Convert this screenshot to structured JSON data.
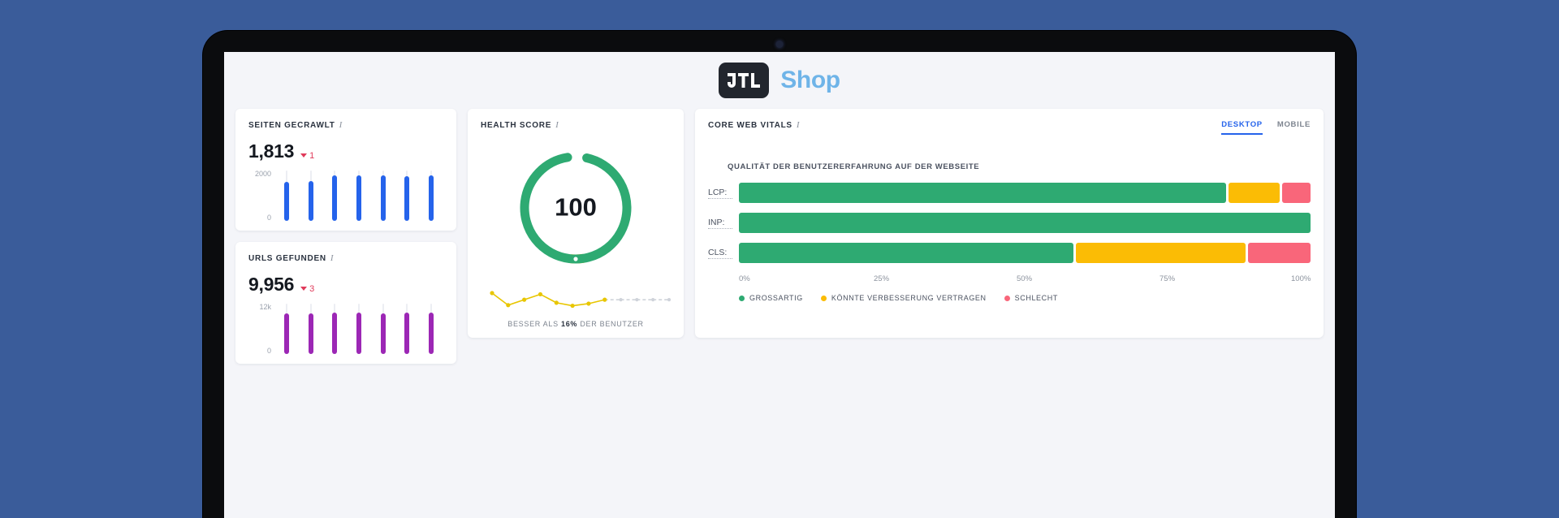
{
  "brand": {
    "mark_text": "JTL",
    "word": "Shop"
  },
  "cards": {
    "pages_crawled": {
      "title": "SEITEN GECRAWLT",
      "info_icon": "info-italic-icon",
      "value": "1,813",
      "delta": "1",
      "delta_direction": "down",
      "axis_top": "2000",
      "axis_bottom": "0"
    },
    "urls_found": {
      "title": "URLS GEFUNDEN",
      "info_icon": "info-italic-icon",
      "value": "9,956",
      "delta": "3",
      "delta_direction": "down",
      "axis_top": "12k",
      "axis_bottom": "0"
    },
    "health_score": {
      "title": "HEALTH SCORE",
      "info_icon": "info-italic-icon",
      "score": "100",
      "note_prefix": "BESSER ALS",
      "note_value": "16%",
      "note_suffix": "DER BENUTZER"
    },
    "core_web_vitals": {
      "title": "CORE WEB VITALS",
      "info_icon": "info-italic-icon",
      "tabs": [
        {
          "label": "DESKTOP",
          "active": true
        },
        {
          "label": "MOBILE",
          "active": false
        }
      ],
      "subtitle": "QUALITÄT DER BENUTZERERFAHRUNG AUF DER WEBSEITE",
      "rows": [
        {
          "label": "LCP:",
          "good": 86,
          "mid": 9,
          "bad": 5
        },
        {
          "label": "INP:",
          "good": 100,
          "mid": 0,
          "bad": 0
        },
        {
          "label": "CLS:",
          "good": 59,
          "mid": 30,
          "bad": 11
        }
      ],
      "scale": [
        "0%",
        "25%",
        "50%",
        "75%",
        "100%"
      ],
      "legend": [
        {
          "label": "GROSSARTIG",
          "color": "#2eaa72"
        },
        {
          "label": "KÖNNTE VERBESSERUNG VERTRAGEN",
          "color": "#fbbc05"
        },
        {
          "label": "SCHLECHT",
          "color": "#f9667a"
        }
      ]
    }
  },
  "chart_data": [
    {
      "type": "bar",
      "name": "seiten-gecrawlt-sparkline",
      "title": "SEITEN GECRAWLT",
      "categories": [
        "1",
        "2",
        "3",
        "4",
        "5",
        "6",
        "7"
      ],
      "values": [
        1550,
        1580,
        1813,
        1800,
        1795,
        1790,
        1800
      ],
      "ylim": [
        0,
        2000
      ],
      "ylabel": "",
      "color": "#2563eb"
    },
    {
      "type": "bar",
      "name": "urls-gefunden-sparkline",
      "title": "URLS GEFUNDEN",
      "categories": [
        "1",
        "2",
        "3",
        "4",
        "5",
        "6",
        "7"
      ],
      "values": [
        9600,
        9750,
        9900,
        9850,
        9700,
        9956,
        9900
      ],
      "ylim": [
        0,
        12000
      ],
      "ylabel": "",
      "color": "#9c27b5"
    },
    {
      "type": "pie",
      "name": "health-score-gauge",
      "title": "HEALTH SCORE",
      "categories": [
        "score",
        "rest"
      ],
      "values": [
        100,
        0
      ],
      "ylim": [
        0,
        100
      ],
      "color": "#2eaa72"
    },
    {
      "type": "line",
      "name": "health-score-trend",
      "title": "BESSER ALS 16% DER BENUTZER",
      "x": [
        0,
        1,
        2,
        3,
        4,
        5,
        6,
        7,
        8,
        9,
        10,
        11
      ],
      "values": [
        62,
        22,
        40,
        58,
        30,
        20,
        27,
        40,
        40,
        40,
        40,
        40
      ],
      "ylim": [
        0,
        70
      ],
      "color": "#e8c600"
    },
    {
      "type": "bar",
      "name": "core-web-vitals-stacked",
      "title": "QUALITÄT DER BENUTZERERFAHRUNG AUF DER WEBSEITE",
      "categories": [
        "LCP:",
        "INP:",
        "CLS:"
      ],
      "series": [
        {
          "name": "GROSSARTIG",
          "values": [
            86,
            100,
            59
          ]
        },
        {
          "name": "KÖNNTE VERBESSERUNG VERTRAGEN",
          "values": [
            9,
            0,
            30
          ]
        },
        {
          "name": "SCHLECHT",
          "values": [
            5,
            0,
            11
          ]
        }
      ],
      "xlabel": "",
      "ylabel": "",
      "xlim": [
        0,
        100
      ],
      "grid": false,
      "legend_position": "bottom"
    }
  ]
}
